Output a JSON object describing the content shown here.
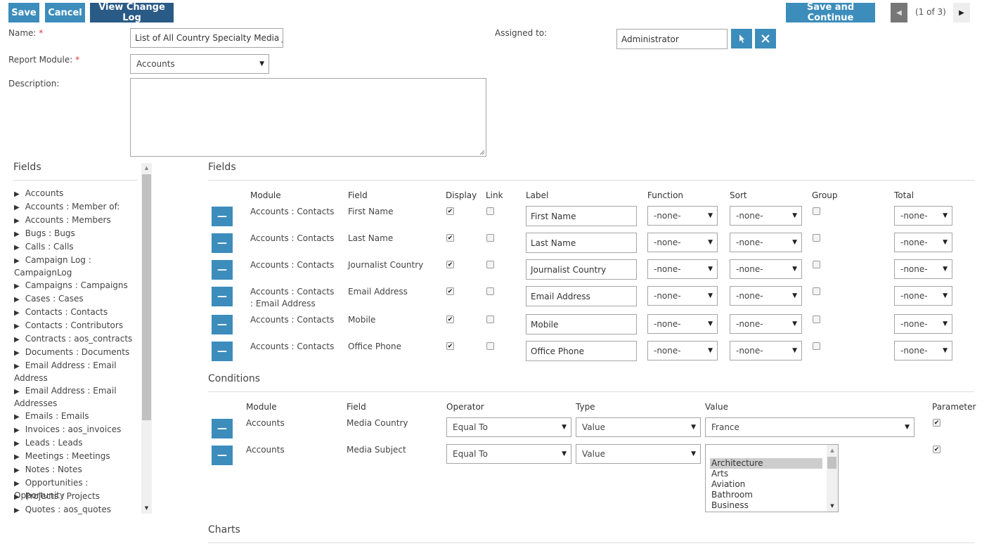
{
  "toolbar": {
    "save": "Save",
    "cancel": "Cancel",
    "view_change_log": "View Change Log",
    "save_and_continue": "Save and Continue",
    "pager": "(1 of 3)"
  },
  "form": {
    "name_label": "Name:",
    "name_value": "List of All Country Specialty Media Journalists",
    "report_module_label": "Report Module:",
    "report_module_value": "Accounts",
    "description_label": "Description:",
    "description_value": "",
    "assigned_to_label": "Assigned to:",
    "assigned_to_value": "Administrator",
    "required_marker": "*"
  },
  "tree": {
    "title": "Fields",
    "items": [
      "Accounts",
      "Accounts : Member of:",
      "Accounts : Members",
      "Bugs : Bugs",
      "Calls : Calls",
      "Campaign Log : CampaignLog",
      "Campaigns : Campaigns",
      "Cases : Cases",
      "Contacts : Contacts",
      "Contacts : Contributors",
      "Contracts : aos_contracts",
      "Documents : Documents",
      "Email Address : Email Address",
      "Email Address : Email Addresses",
      "Emails : Emails",
      "Invoices : aos_invoices",
      "Leads : Leads",
      "Meetings : Meetings",
      "Notes : Notes",
      "Opportunities : Opportunity",
      "Projects : Projects",
      "Quotes : aos_quotes"
    ]
  },
  "fields": {
    "title": "Fields",
    "headers": {
      "module": "Module",
      "field": "Field",
      "display": "Display",
      "link": "Link",
      "label": "Label",
      "function": "Function",
      "sort": "Sort",
      "group": "Group",
      "total": "Total"
    },
    "rows": [
      {
        "module": "Accounts : Contacts",
        "field": "First Name",
        "label": "First Name",
        "function": "-none-",
        "sort": "-none-",
        "total": "-none-",
        "display": true,
        "link": false,
        "group": false
      },
      {
        "module": "Accounts : Contacts",
        "field": "Last Name",
        "label": "Last Name",
        "function": "-none-",
        "sort": "-none-",
        "total": "-none-",
        "display": true,
        "link": false,
        "group": false
      },
      {
        "module": "Accounts : Contacts",
        "field": "Journalist Country",
        "label": "Journalist Country",
        "function": "-none-",
        "sort": "-none-",
        "total": "-none-",
        "display": true,
        "link": false,
        "group": false
      },
      {
        "module": "Accounts : Contacts : Email Address",
        "field": "Email Address",
        "label": "Email Address",
        "function": "-none-",
        "sort": "-none-",
        "total": "-none-",
        "display": true,
        "link": false,
        "group": false
      },
      {
        "module": "Accounts : Contacts",
        "field": "Mobile",
        "label": "Mobile",
        "function": "-none-",
        "sort": "-none-",
        "total": "-none-",
        "display": true,
        "link": false,
        "group": false
      },
      {
        "module": "Accounts : Contacts",
        "field": "Office Phone",
        "label": "Office Phone",
        "function": "-none-",
        "sort": "-none-",
        "total": "-none-",
        "display": true,
        "link": false,
        "group": false
      }
    ]
  },
  "conditions": {
    "title": "Conditions",
    "headers": {
      "module": "Module",
      "field": "Field",
      "operator": "Operator",
      "type": "Type",
      "value": "Value",
      "parameter": "Parameter"
    },
    "rows": [
      {
        "module": "Accounts",
        "field": "Media Country",
        "operator": "Equal To",
        "type": "Value",
        "value": "France",
        "parameter": true
      },
      {
        "module": "Accounts",
        "field": "Media Subject",
        "operator": "Equal To",
        "type": "Value",
        "parameter": true
      }
    ],
    "subject_options": [
      "Architecture",
      "Arts",
      "Aviation",
      "Bathroom",
      "Business"
    ],
    "subject_selected": "Architecture"
  },
  "charts": {
    "title": "Charts"
  },
  "colors": {
    "primary": "#3c8dbc",
    "primary_dark": "#2a5a86",
    "pager_bg": "#777777"
  }
}
